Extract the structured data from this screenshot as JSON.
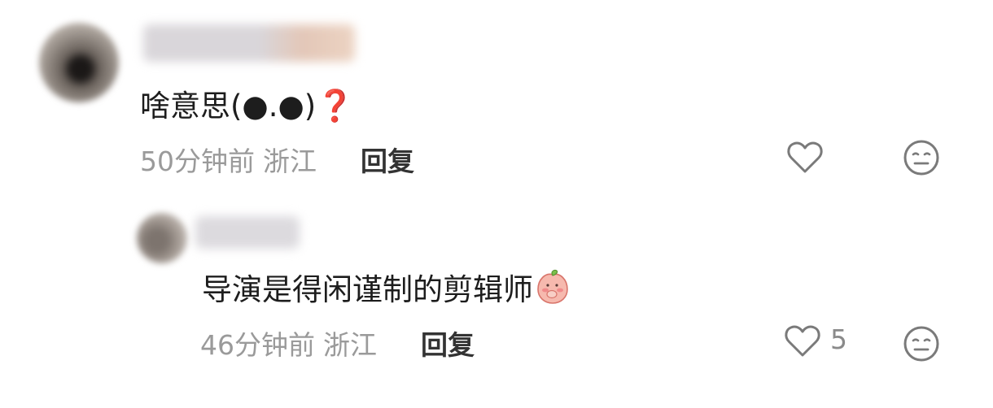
{
  "comments": [
    {
      "text": "啥意思(●.●)",
      "emoji": "❓",
      "time": "50分钟前",
      "location": "浙江",
      "reply_label": "回复",
      "like_count": ""
    },
    {
      "text": "导演是得闲谨制的剪辑师",
      "emoji": "peach-face-emoji",
      "time": "46分钟前",
      "location": "浙江",
      "reply_label": "回复",
      "like_count": "5"
    }
  ],
  "icons": {
    "like": "heart-outline-icon",
    "dislike": "neutral-face-icon"
  },
  "colors": {
    "text": "#1d1d1d",
    "meta": "#9a9a9a",
    "reply": "#333333",
    "icon": "#7a7a7a"
  }
}
